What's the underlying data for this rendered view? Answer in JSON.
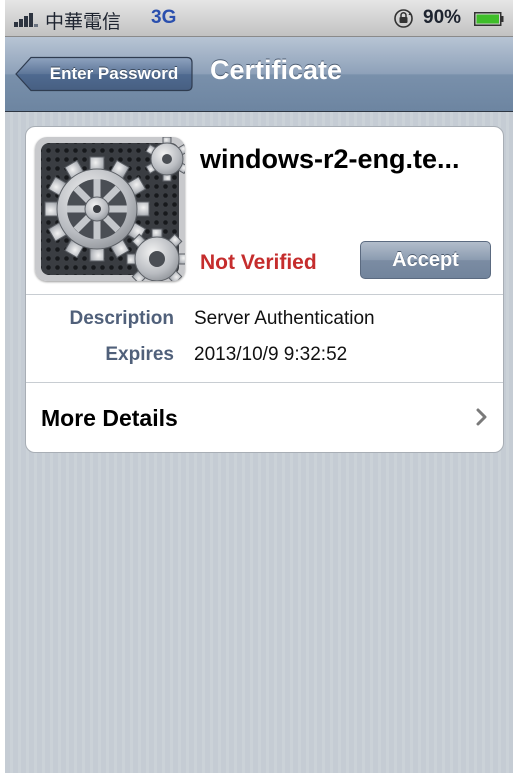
{
  "status_bar": {
    "carrier": "中華電信",
    "network": "3G",
    "battery_percent": "90%",
    "signal_icon": "signal-bars-icon",
    "lock_icon": "rotation-lock-icon",
    "battery_icon": "battery-icon",
    "battery_color": "#3fbe2a"
  },
  "nav": {
    "back_label": "Enter Password",
    "title": "Certificate",
    "bar_color": "#7990ab"
  },
  "certificate": {
    "name": "windows-r2-eng.te...",
    "status": "Not Verified",
    "status_color": "#c52d2d",
    "accept_label": "Accept",
    "icon": "gears-icon",
    "details": [
      {
        "label": "Description",
        "value": "Server Authentication"
      },
      {
        "label": "Expires",
        "value": "2013/10/9 9:32:52"
      }
    ],
    "more_details_label": "More Details",
    "chevron_icon": "chevron-right-icon"
  }
}
